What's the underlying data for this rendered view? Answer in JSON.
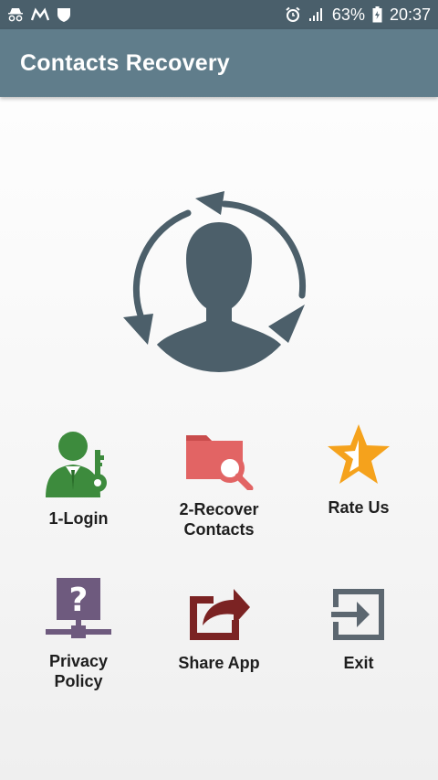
{
  "status_bar": {
    "battery": "63%",
    "time": "20:37"
  },
  "app_bar": {
    "title": "Contacts Recovery"
  },
  "menu": {
    "login": {
      "label": "1-Login",
      "icon": "user-key-icon",
      "color": "#3d8b3d"
    },
    "recover": {
      "label": "2-Recover\nContacts",
      "icon": "folder-search-icon",
      "color": "#e26464"
    },
    "rate": {
      "label": "Rate Us",
      "icon": "star-icon",
      "color": "#f5a21c"
    },
    "privacy": {
      "label": "Privacy\nPolicy",
      "icon": "question-network-icon",
      "color": "#6e5a7e"
    },
    "share": {
      "label": "Share App",
      "icon": "share-icon",
      "color": "#7b2323"
    },
    "exit": {
      "label": "Exit",
      "icon": "exit-icon",
      "color": "#5c6770"
    }
  },
  "colors": {
    "status_bar": "#4a5f6b",
    "app_bar": "#607d8b",
    "hero": "#4c5f6a"
  }
}
